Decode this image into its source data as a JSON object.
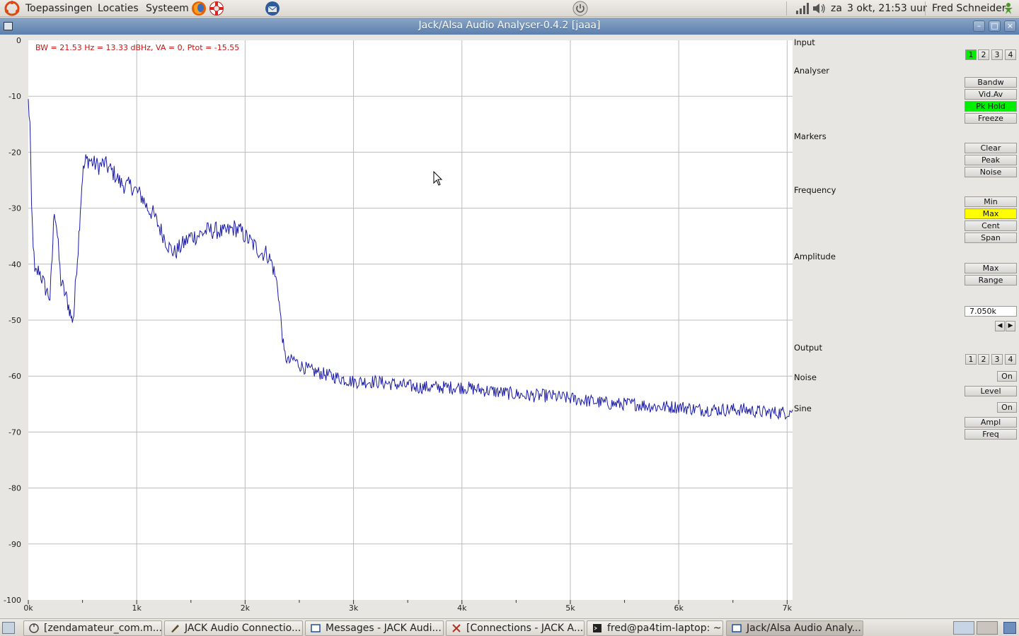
{
  "topbar": {
    "menu_applications": "Toepassingen",
    "menu_places": "Locaties",
    "menu_system": "Systeem",
    "day": "za",
    "datetime": "3 okt, 21:53 uur",
    "user": "Fred Schneider",
    "icons": [
      "ubuntu-logo-icon",
      "firefox-icon",
      "help-lifebuoy-icon",
      "thunderbird-icon",
      "power-icon",
      "network-icon",
      "volume-icon",
      "user-status-icon"
    ]
  },
  "window": {
    "title": "Jack/Alsa Audio Analyser-0.4.2  [jaaa]",
    "controls": [
      "minimize-icon",
      "maximize-icon",
      "close-icon"
    ]
  },
  "status_text": "BW = 21.53 Hz = 13.33 dBHz, VA = 0, Ptot = -15.55",
  "panel": {
    "input_label": "Input",
    "input_channels": [
      "1",
      "2",
      "3",
      "4"
    ],
    "input_selected": "1",
    "analyser_label": "Analyser",
    "analyser_buttons": [
      {
        "label": "Bandw",
        "state": "off"
      },
      {
        "label": "Vid.Av",
        "state": "off"
      },
      {
        "label": "Pk Hold",
        "state": "green"
      },
      {
        "label": "Freeze",
        "state": "off"
      }
    ],
    "markers_label": "Markers",
    "markers_buttons": [
      {
        "label": "Clear",
        "state": "off"
      },
      {
        "label": "Peak",
        "state": "off"
      },
      {
        "label": "Noise",
        "state": "off"
      }
    ],
    "frequency_label": "Frequency",
    "frequency_buttons": [
      {
        "label": "Min",
        "state": "off"
      },
      {
        "label": "Max",
        "state": "yellow"
      },
      {
        "label": "Cent",
        "state": "off"
      },
      {
        "label": "Span",
        "state": "off"
      }
    ],
    "amplitude_label": "Amplitude",
    "amplitude_buttons": [
      {
        "label": "Max",
        "state": "off"
      },
      {
        "label": "Range",
        "state": "off"
      }
    ],
    "value_field": "7.050k",
    "output_label": "Output",
    "output_channels": [
      "1",
      "2",
      "3",
      "4"
    ],
    "noise_label": "Noise",
    "noise_on": "On",
    "noise_level": "Level",
    "sine_label": "Sine",
    "sine_on": "On",
    "sine_ampl": "Ampl",
    "sine_freq": "Freq"
  },
  "taskbar": {
    "tasks": [
      {
        "label": "[zendamateur_com.m...",
        "icon": "browser-icon"
      },
      {
        "label": "JACK Audio Connectio...",
        "icon": "jack-icon"
      },
      {
        "label": "Messages - JACK Audi...",
        "icon": "window-icon"
      },
      {
        "label": "[Connections - JACK A...",
        "icon": "connections-icon"
      },
      {
        "label": "fred@pa4tim-laptop: ~",
        "icon": "terminal-icon"
      },
      {
        "label": "Jack/Alsa Audio Analy...",
        "icon": "window-icon"
      }
    ]
  },
  "chart_data": {
    "type": "line",
    "xlabel": "",
    "ylabel": "",
    "xlim": [
      0,
      7050
    ],
    "ylim": [
      -100,
      0
    ],
    "x_ticks": [
      "0k",
      "1k",
      "2k",
      "3k",
      "4k",
      "5k",
      "6k",
      "7k"
    ],
    "y_ticks": [
      "0",
      "-10",
      "-20",
      "-30",
      "-40",
      "-50",
      "-60",
      "-70",
      "-80",
      "-90",
      "-100"
    ],
    "grid": true,
    "line_color": "#1a1aa8",
    "series": [
      {
        "x": [
          0,
          15,
          30,
          60,
          100,
          150,
          200,
          220,
          240,
          260,
          300,
          350,
          380,
          400,
          420,
          440,
          460,
          480,
          500,
          530,
          560,
          600,
          650,
          700,
          750,
          800,
          850,
          900,
          950,
          1000,
          1050,
          1100,
          1150,
          1200,
          1250,
          1300,
          1350,
          1400,
          1450,
          1500,
          1550,
          1600,
          1650,
          1700,
          1750,
          1800,
          1850,
          1900,
          1950,
          2000,
          2050,
          2100,
          2150,
          2200,
          2250,
          2300,
          2330,
          2360,
          2400,
          2450,
          2500,
          2600,
          2700,
          2800,
          2900,
          3000,
          3200,
          3400,
          3600,
          3800,
          4000,
          4200,
          4400,
          4600,
          4800,
          5000,
          5200,
          5400,
          5600,
          5800,
          6000,
          6200,
          6400,
          6600,
          6800,
          7000,
          7050
        ],
        "y": [
          -11,
          -15,
          -30,
          -42,
          -41,
          -44,
          -46,
          -39,
          -30,
          -33,
          -43,
          -46,
          -48,
          -50,
          -49,
          -42,
          -37,
          -30,
          -24,
          -21.5,
          -21.3,
          -22,
          -22.5,
          -22,
          -23,
          -24,
          -25.5,
          -26,
          -26,
          -27,
          -28,
          -30,
          -31,
          -33,
          -35,
          -37,
          -38,
          -37,
          -36,
          -35,
          -35,
          -34.5,
          -34,
          -34,
          -34,
          -34.5,
          -34,
          -33.5,
          -34,
          -35,
          -36,
          -37,
          -38,
          -38,
          -40,
          -44,
          -50,
          -56,
          -57.5,
          -57,
          -58,
          -59,
          -59.5,
          -60,
          -60.5,
          -61,
          -61,
          -61.5,
          -62,
          -62,
          -62,
          -62.5,
          -63,
          -63.5,
          -63.5,
          -64,
          -64.5,
          -65,
          -65,
          -65.5,
          -65.5,
          -66,
          -66,
          -66,
          -66.5,
          -66.5,
          -66
        ]
      }
    ]
  }
}
